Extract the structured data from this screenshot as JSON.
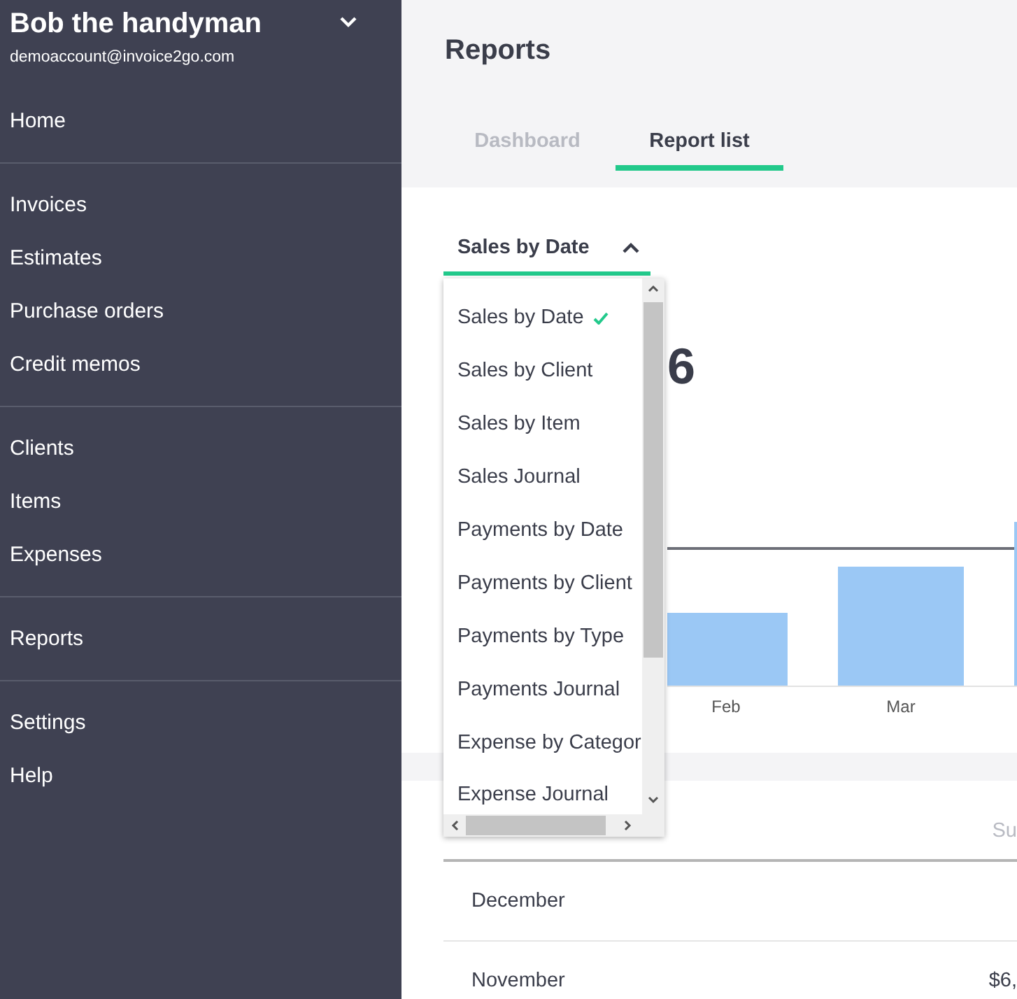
{
  "sidebar": {
    "account_name": "Bob the handyman",
    "email": "demoaccount@invoice2go.com",
    "groups": [
      {
        "items": [
          "Home"
        ]
      },
      {
        "items": [
          "Invoices",
          "Estimates",
          "Purchase orders",
          "Credit memos"
        ]
      },
      {
        "items": [
          "Clients",
          "Items",
          "Expenses"
        ]
      },
      {
        "items": [
          "Reports"
        ]
      },
      {
        "items": [
          "Settings",
          "Help"
        ]
      }
    ]
  },
  "page_title": "Reports",
  "tabs": [
    {
      "label": "Dashboard",
      "selected": false
    },
    {
      "label": "Report list",
      "selected": true
    }
  ],
  "report_select": {
    "value": "Sales by Date",
    "expanded": true,
    "options": [
      {
        "label": "Sales by Date",
        "selected": true
      },
      {
        "label": "Sales by Client",
        "selected": false
      },
      {
        "label": "Sales by Item",
        "selected": false
      },
      {
        "label": "Sales Journal",
        "selected": false
      },
      {
        "label": "Payments by Date",
        "selected": false
      },
      {
        "label": "Payments by Client",
        "selected": false
      },
      {
        "label": "Payments by Type",
        "selected": false
      },
      {
        "label": "Payments Journal",
        "selected": false
      },
      {
        "label": "Expense by Categor",
        "selected": false
      },
      {
        "label": "Expense Journal",
        "selected": false
      }
    ]
  },
  "summary": {
    "total": "6"
  },
  "chart": {
    "labels": [
      "Feb",
      "Mar"
    ]
  },
  "table": {
    "column_2": "Su",
    "rows": [
      {
        "month": "December"
      },
      {
        "month": "November",
        "column_2": "$6,"
      }
    ]
  }
}
